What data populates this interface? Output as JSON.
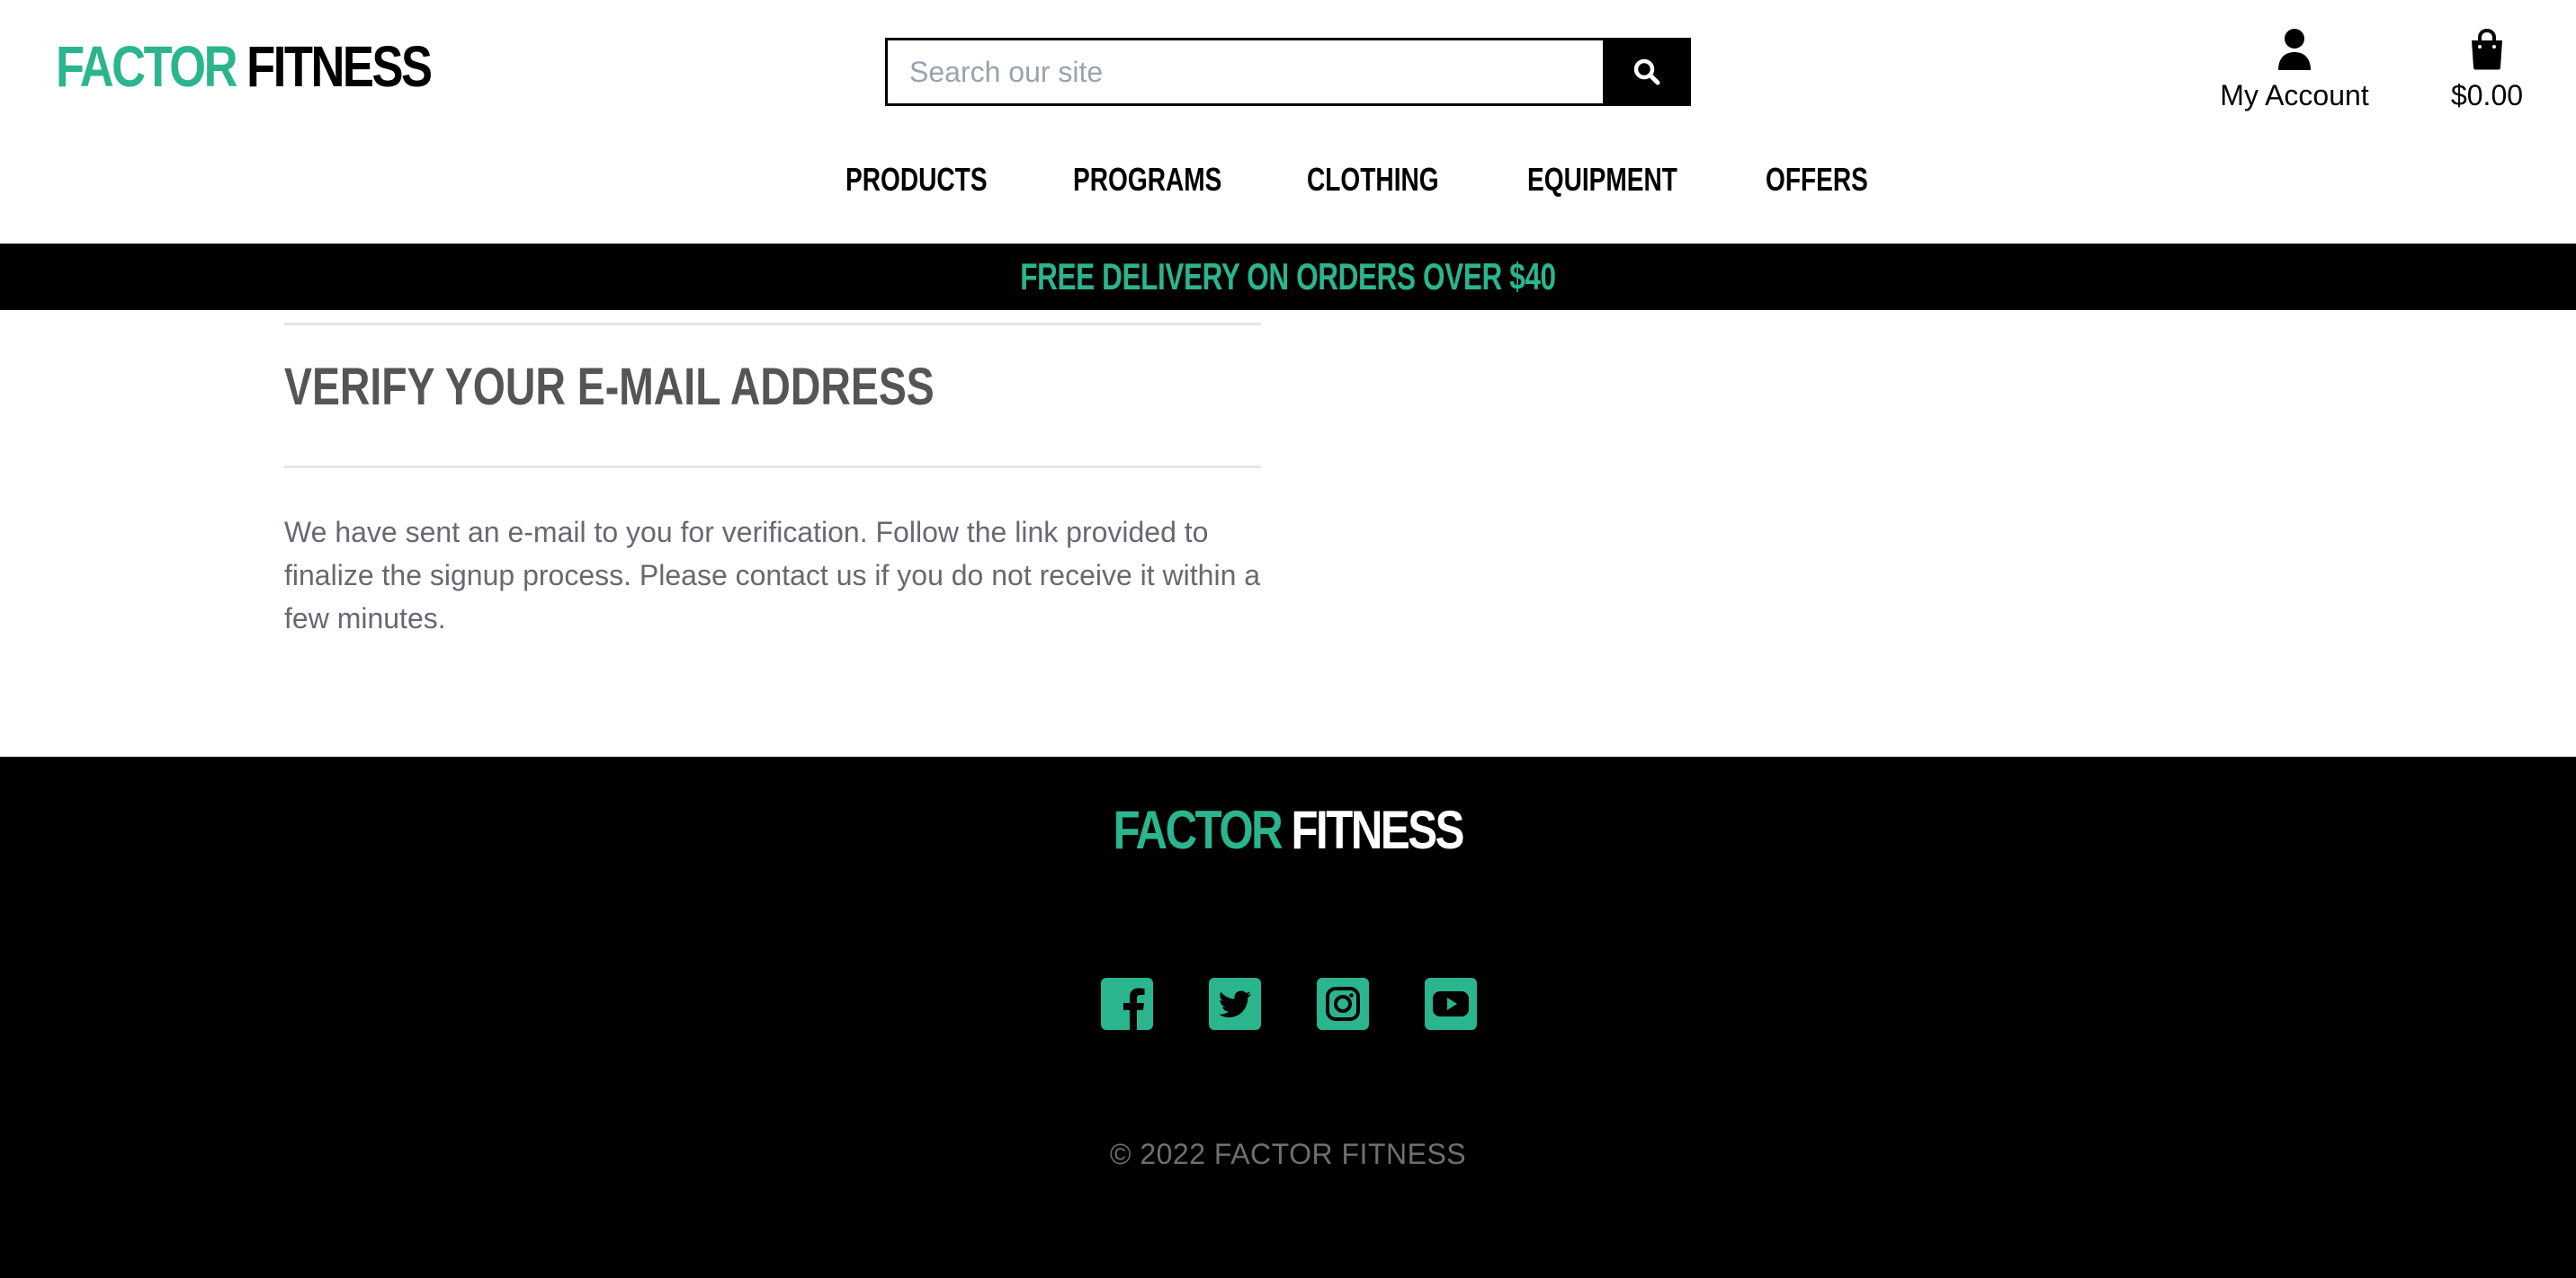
{
  "brand": {
    "name_part1": "FACTOR",
    "name_part2": "FITNESS",
    "accent_color": "#2bb58f"
  },
  "header": {
    "search": {
      "placeholder": "Search our site",
      "value": "",
      "button_icon": "search-icon"
    },
    "account": {
      "icon": "user-icon",
      "label": "My Account"
    },
    "cart": {
      "icon": "shopping-bag-icon",
      "total": "$0.00"
    }
  },
  "nav": {
    "items": [
      {
        "label": "PRODUCTS"
      },
      {
        "label": "PROGRAMS"
      },
      {
        "label": "CLOTHING"
      },
      {
        "label": "EQUIPMENT"
      },
      {
        "label": "OFFERS"
      }
    ]
  },
  "banner": {
    "text": "FREE DELIVERY ON ORDERS OVER $40"
  },
  "main": {
    "title": "VERIFY YOUR E-MAIL ADDRESS",
    "message": "We have sent an e-mail to you for verification. Follow the link provided to finalize the signup process. Please contact us if you do not receive it within a few minutes."
  },
  "footer": {
    "socials": [
      {
        "icon": "facebook-icon"
      },
      {
        "icon": "twitter-icon"
      },
      {
        "icon": "instagram-icon"
      },
      {
        "icon": "youtube-icon"
      }
    ],
    "copyright": "© 2022 FACTOR FITNESS"
  }
}
